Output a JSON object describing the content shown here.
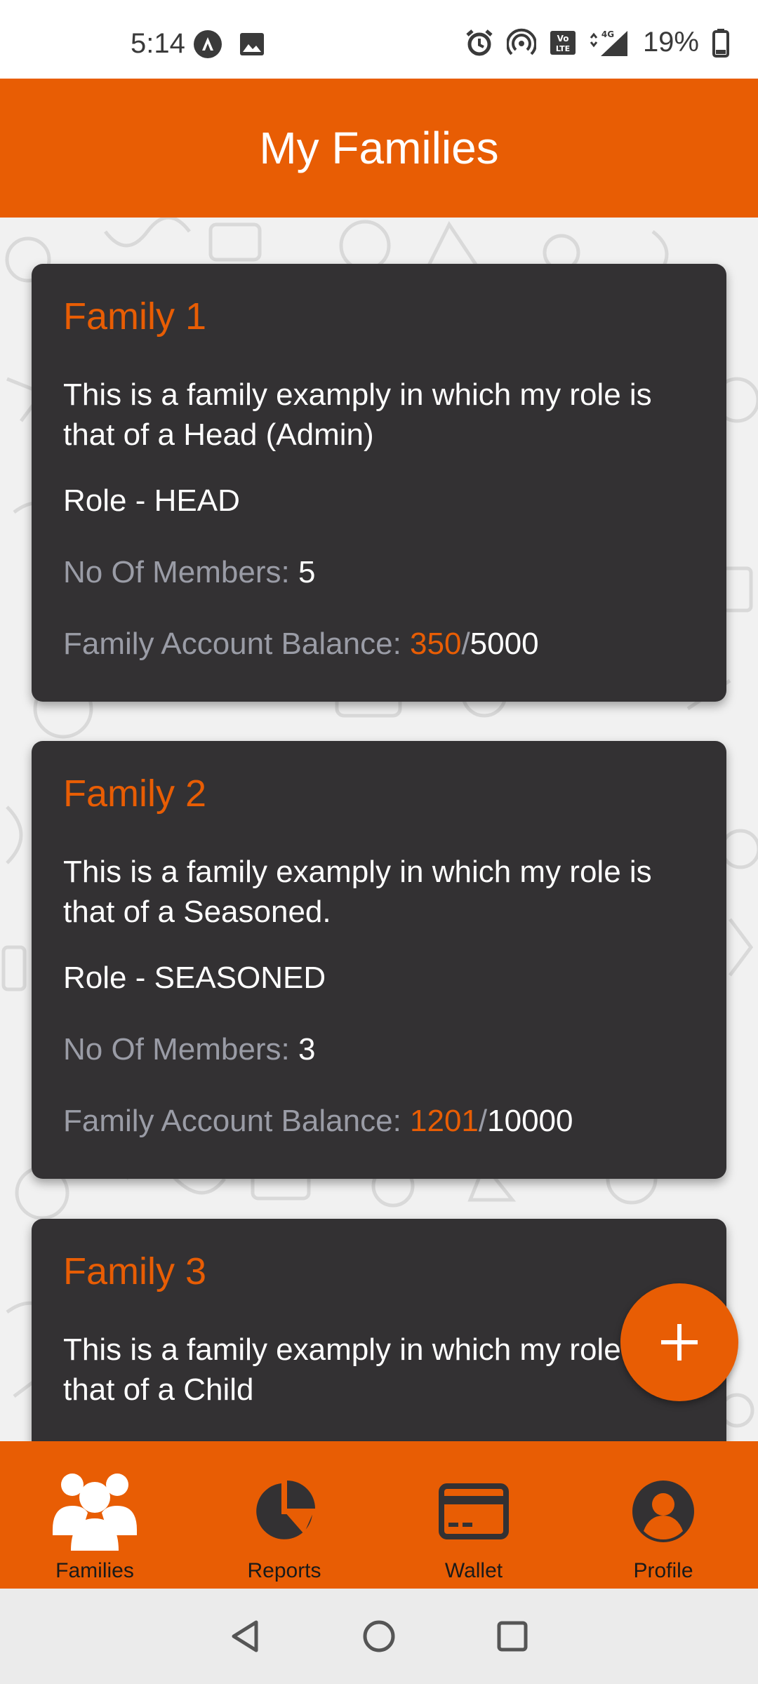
{
  "status_bar": {
    "time": "5:14",
    "battery": "19%",
    "network": "4G"
  },
  "header": {
    "title": "My Families"
  },
  "families": [
    {
      "name": "Family 1",
      "description": "This is a family examply in which my role is that of a Head (Admin)",
      "role": "Role - HEAD",
      "members_label": "No Of Members: ",
      "members": "5",
      "balance_label": "Family Account Balance: ",
      "balance": "350",
      "separator": "/",
      "limit": "5000"
    },
    {
      "name": "Family 2",
      "description": "This is a family examply in which my role is that of a Seasoned.",
      "role": "Role - SEASONED",
      "members_label": "No Of Members: ",
      "members": "3",
      "balance_label": "Family Account Balance: ",
      "balance": "1201",
      "separator": "/",
      "limit": "10000"
    },
    {
      "name": "Family 3",
      "description": "This is a family examply in which my role is that of a Child"
    }
  ],
  "fab": {
    "icon": "plus-icon"
  },
  "bottom_nav": {
    "items": [
      {
        "label": "Families",
        "icon": "families-icon",
        "active": true
      },
      {
        "label": "Reports",
        "icon": "pie-chart-icon",
        "active": false
      },
      {
        "label": "Wallet",
        "icon": "credit-card-icon",
        "active": false
      },
      {
        "label": "Profile",
        "icon": "account-circle-icon",
        "active": false
      }
    ]
  },
  "colors": {
    "accent": "#E85D04",
    "card": "#333133",
    "muted": "#9a9ca6"
  }
}
